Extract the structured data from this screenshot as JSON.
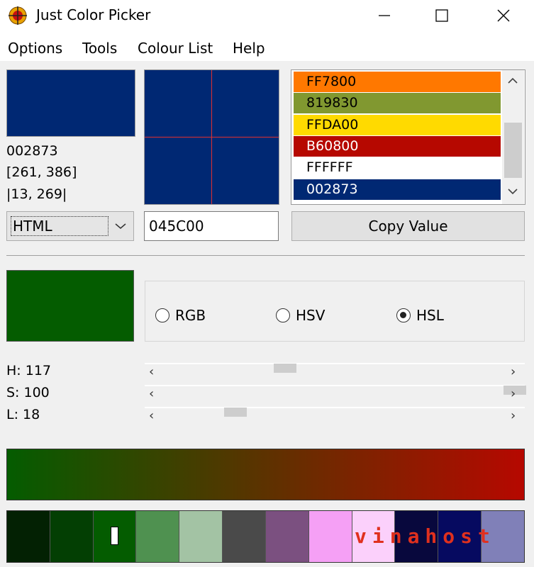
{
  "window": {
    "title": "Just Color Picker",
    "icon": "crosshair-target-icon",
    "controls": [
      "minimize-icon",
      "maximize-icon",
      "close-icon"
    ]
  },
  "menu": {
    "items": [
      {
        "label": "Options"
      },
      {
        "label": "Tools"
      },
      {
        "label": "Colour List"
      },
      {
        "label": "Help"
      }
    ]
  },
  "current": {
    "color": "#002873",
    "hex": "002873",
    "position": "[261, 386]",
    "delta": "|13, 269|"
  },
  "magnifier": {
    "color": "#002873",
    "crosshair_color": "#e03030"
  },
  "colour_list": {
    "items": [
      {
        "value": "FF7800",
        "bg": "#FF7800",
        "fg": "#000000"
      },
      {
        "value": "819830",
        "bg": "#819830",
        "fg": "#000000"
      },
      {
        "value": "FFDA00",
        "bg": "#FFDA00",
        "fg": "#000000"
      },
      {
        "value": "B60800",
        "bg": "#B60800",
        "fg": "#ffffff"
      },
      {
        "value": "FFFFFF",
        "bg": "#FFFFFF",
        "fg": "#000000"
      },
      {
        "value": "002873",
        "bg": "#002873",
        "fg": "#ffffff"
      }
    ]
  },
  "format": {
    "selected": "HTML"
  },
  "value_input": {
    "value": "045C00"
  },
  "copy_button": {
    "label": "Copy Value"
  },
  "editor": {
    "color": "#045C00",
    "modes": [
      {
        "label": "RGB",
        "selected": false
      },
      {
        "label": "HSV",
        "selected": false
      },
      {
        "label": "HSL",
        "selected": true
      }
    ],
    "sliders": [
      {
        "label": "H: 117",
        "value": 117,
        "max": 360
      },
      {
        "label": "S: 100",
        "value": 100,
        "max": 100
      },
      {
        "label": "L: 18",
        "value": 18,
        "max": 100
      }
    ]
  },
  "gradient": {
    "from": "#045C00",
    "to": "#B60800"
  },
  "palette": {
    "colors": [
      "#032103",
      "#033f03",
      "#045c00",
      "#4f9150",
      "#a3c3a4",
      "#4a4a4a",
      "#7b5080",
      "#f5a0f5",
      "#fbd0fb",
      "#08083d",
      "#060a60",
      "#8080b8"
    ]
  },
  "watermark": {
    "text": "vinahost"
  }
}
